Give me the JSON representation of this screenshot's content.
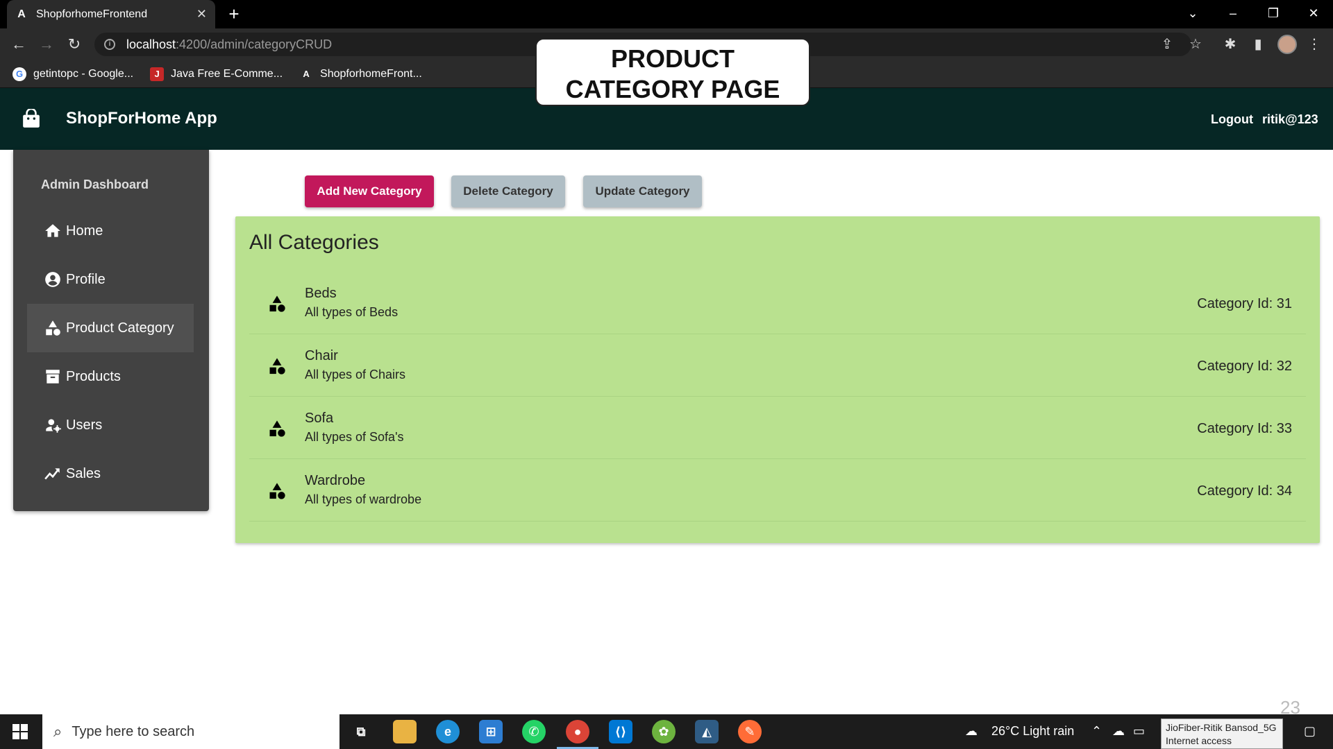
{
  "browser": {
    "tab_title": "ShopforhomeFrontend",
    "tab_close": "✕",
    "new_tab": "+",
    "url_host": "localhost",
    "url_path": ":4200/admin/categoryCRUD",
    "bookmarks": [
      {
        "label": "getintopc - Google..."
      },
      {
        "label": "Java Free E-Comme..."
      },
      {
        "label": "ShopforhomeFront..."
      }
    ]
  },
  "callout": {
    "line1": "PRODUCT",
    "line2": "CATEGORY PAGE"
  },
  "app": {
    "title": "ShopForHome App",
    "logout": "Logout",
    "user": "ritik@123"
  },
  "sidebar": {
    "heading": "Admin Dashboard",
    "items": [
      {
        "label": "Home",
        "icon": "home-icon"
      },
      {
        "label": "Profile",
        "icon": "account-circle-icon"
      },
      {
        "label": "Product Category",
        "icon": "category-icon"
      },
      {
        "label": "Products",
        "icon": "archive-icon"
      },
      {
        "label": "Users",
        "icon": "manage-accounts-icon"
      },
      {
        "label": "Sales",
        "icon": "trending-up-icon"
      }
    ],
    "active": "Product Category"
  },
  "actions": {
    "add": "Add New Category",
    "delete": "Delete Category",
    "update": "Update Category"
  },
  "categories": {
    "title": "All Categories",
    "items": [
      {
        "name": "Beds",
        "desc": "All types of Beds",
        "id": "Category Id: 31"
      },
      {
        "name": "Chair",
        "desc": "All types of Chairs",
        "id": "Category Id: 32"
      },
      {
        "name": "Sofa",
        "desc": "All types of Sofa's",
        "id": "Category Id: 33"
      },
      {
        "name": "Wardrobe",
        "desc": "All types of wardrobe",
        "id": "Category Id: 34"
      }
    ]
  },
  "page_number": "23",
  "taskbar": {
    "search_placeholder": "Type here to search",
    "weather": "26°C  Light rain",
    "wifi_name": "JioFiber-Ritik Bansod_5G",
    "wifi_status": "Internet access"
  },
  "colors": {
    "appbar": "#062725",
    "sidebar": "#424242",
    "panel": "#b9e18f",
    "add_button": "#c2185b",
    "secondary_button": "#b0bec5"
  }
}
